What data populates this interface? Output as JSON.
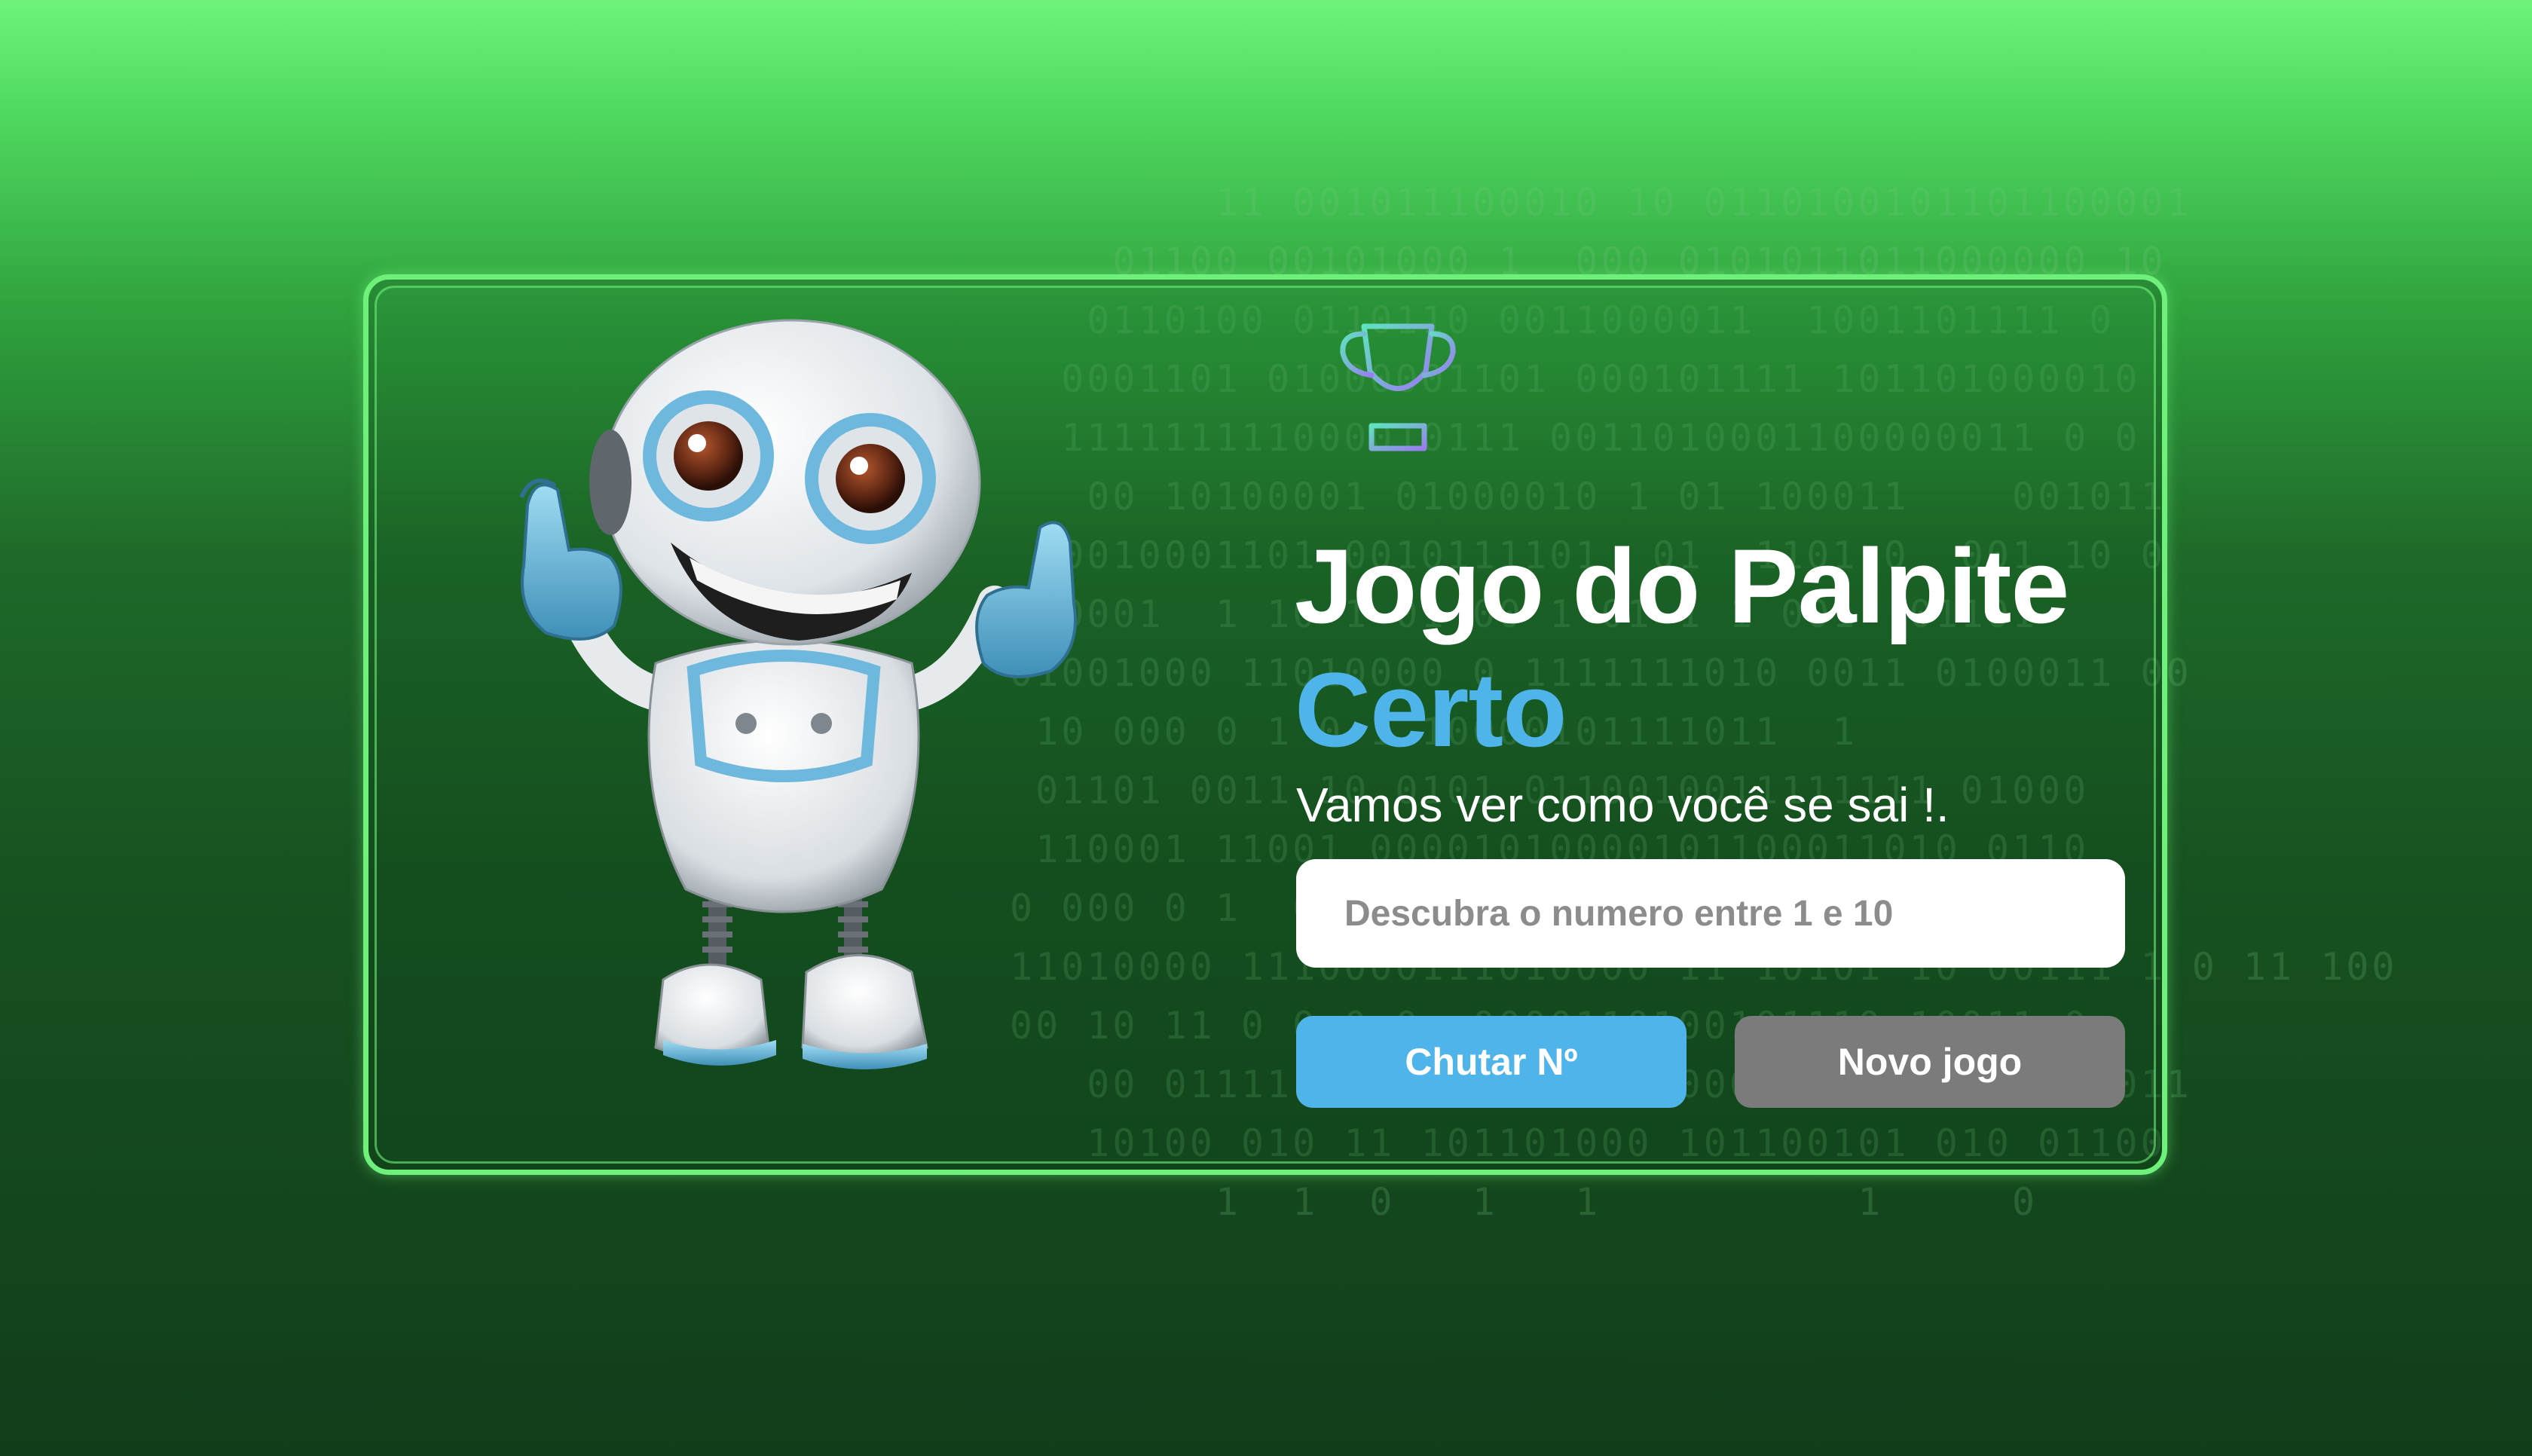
{
  "app": {
    "title_main": "Jogo do Palpite",
    "title_accent": "Certo",
    "subtitle": "Vamos ver como você se sai !."
  },
  "input": {
    "value": "",
    "placeholder": "Descubra o numero entre 1 e 10"
  },
  "buttons": {
    "guess_label": "Chutar Nº",
    "new_game_label": "Novo jogo"
  },
  "binary_rows": [
    "        11 001011100010 10 0110100101101100001",
    "    01100 00101000 1  000 0101011011000000 10",
    "   0110100 0110110 0011000011  1001101111 0",
    "  0001101 01000001101 000101111 101101000010",
    "  111111111000010111 0011010001100000011 0 0",
    "   00 10100001 01000010 1 01 100011    001011",
    "  0010001101 0010111101  01  1101 0  001 10 0",
    " 10001  1 10 1 01 00 1 01 1 1 001  01101",
    "01001000 11010000 0 1111111010 0011 0100011 00",
    " 10 000 0 1 0 1 10000101111011  1",
    " 01101 0011 10 0101 0110010011111111 01000",
    " 110001 11001 00001010000101100011010 0110",
    "0 000 0 1  01 0 0 0 1 1 0 1  0 1 0 1010",
    "11010000 1110000111010000 11 10101 10 00111 1 0 11 100",
    "00 10 11 0 0 0 0  0000110100101110 10011 0",
    "   00 01111  101101 00011000000 110100101 1011",
    "   10100 010 11 101101000 101100101 010 01100",
    "        1  1  0   1   1          1     0"
  ],
  "colors": {
    "accent_blue": "#4fb4ea",
    "frame_green": "#6ef07a",
    "new_game_gray": "#7b7b7b",
    "background_top": "#6df37a",
    "background_bottom": "#123d1a"
  },
  "icons": {
    "trophy": "trophy-icon",
    "mascot": "robot-mascot"
  }
}
